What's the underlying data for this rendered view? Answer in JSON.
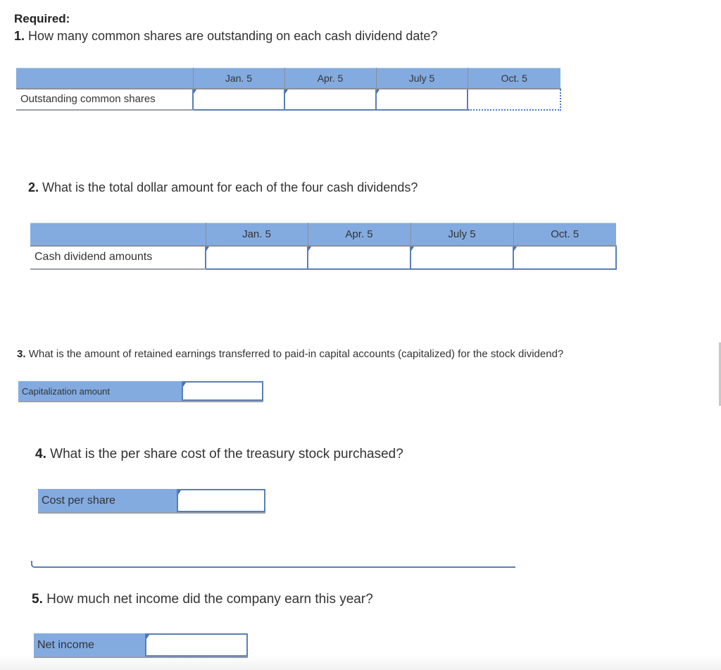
{
  "required_label": "Required:",
  "questions": [
    {
      "number": "1.",
      "text": "How many common shares are outstanding on each cash dividend date?",
      "table": {
        "columns": [
          "Jan. 5",
          "Apr. 5",
          "July 5",
          "Oct. 5"
        ],
        "row_label": "Outstanding common shares",
        "values": [
          "",
          "",
          "",
          ""
        ]
      }
    },
    {
      "number": "2.",
      "text": "What is the total dollar amount for each of the four cash dividends?",
      "table": {
        "columns": [
          "Jan. 5",
          "Apr. 5",
          "July 5",
          "Oct. 5"
        ],
        "row_label": "Cash dividend amounts",
        "values": [
          "",
          "",
          "",
          ""
        ]
      }
    },
    {
      "number": "3.",
      "text": "What is the amount of retained earnings transferred to paid-in capital accounts (capitalized) for the stock dividend?",
      "field": {
        "label": "Capitalization amount",
        "value": ""
      }
    },
    {
      "number": "4.",
      "text": "What is the per share cost of the treasury stock purchased?",
      "field": {
        "label": "Cost per share",
        "value": ""
      }
    },
    {
      "number": "5.",
      "text": "How much net income did the company earn this year?",
      "field": {
        "label": "Net income",
        "value": ""
      }
    }
  ],
  "colors": {
    "header_fill": "#83abe0",
    "input_border": "#5b7fb5",
    "text": "#333333"
  }
}
